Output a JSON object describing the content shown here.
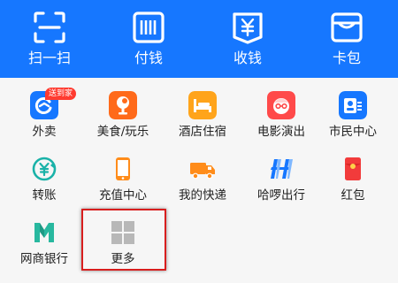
{
  "top_actions": [
    {
      "label": "扫一扫",
      "icon": "scan-icon"
    },
    {
      "label": "付钱",
      "icon": "barcode-pay-icon"
    },
    {
      "label": "收钱",
      "icon": "yuan-receive-icon"
    },
    {
      "label": "卡包",
      "icon": "card-wallet-icon"
    }
  ],
  "apps": [
    {
      "label": "外卖",
      "icon": "food-delivery-icon",
      "color": "#1677ff",
      "badge": "送到家"
    },
    {
      "label": "美食/玩乐",
      "icon": "dining-icon",
      "color": "#ff6a1a"
    },
    {
      "label": "酒店住宿",
      "icon": "hotel-bed-icon",
      "color": "#ffa41b"
    },
    {
      "label": "电影演出",
      "icon": "movie-face-icon",
      "color": "#ff4a4a"
    },
    {
      "label": "市民中心",
      "icon": "citizen-center-icon",
      "color": "#1677ff"
    },
    {
      "label": "转账",
      "icon": "transfer-icon",
      "color": "#1ab2a8"
    },
    {
      "label": "充值中心",
      "icon": "phone-recharge-icon",
      "color": "#ff8c1a"
    },
    {
      "label": "我的快递",
      "icon": "delivery-truck-icon",
      "color": "#ff8c1a"
    },
    {
      "label": "哈啰出行",
      "icon": "hello-bike-icon",
      "color": "#1677ff"
    },
    {
      "label": "红包",
      "icon": "red-packet-icon",
      "color": "#f23b3b"
    },
    {
      "label": "网商银行",
      "icon": "mybank-icon",
      "color": "#28b89f"
    },
    {
      "label": "更多",
      "icon": "more-grid-icon",
      "color": "#b8b8b8"
    }
  ],
  "colors": {
    "header": "#1677ff",
    "highlight": "#d81e1e"
  }
}
